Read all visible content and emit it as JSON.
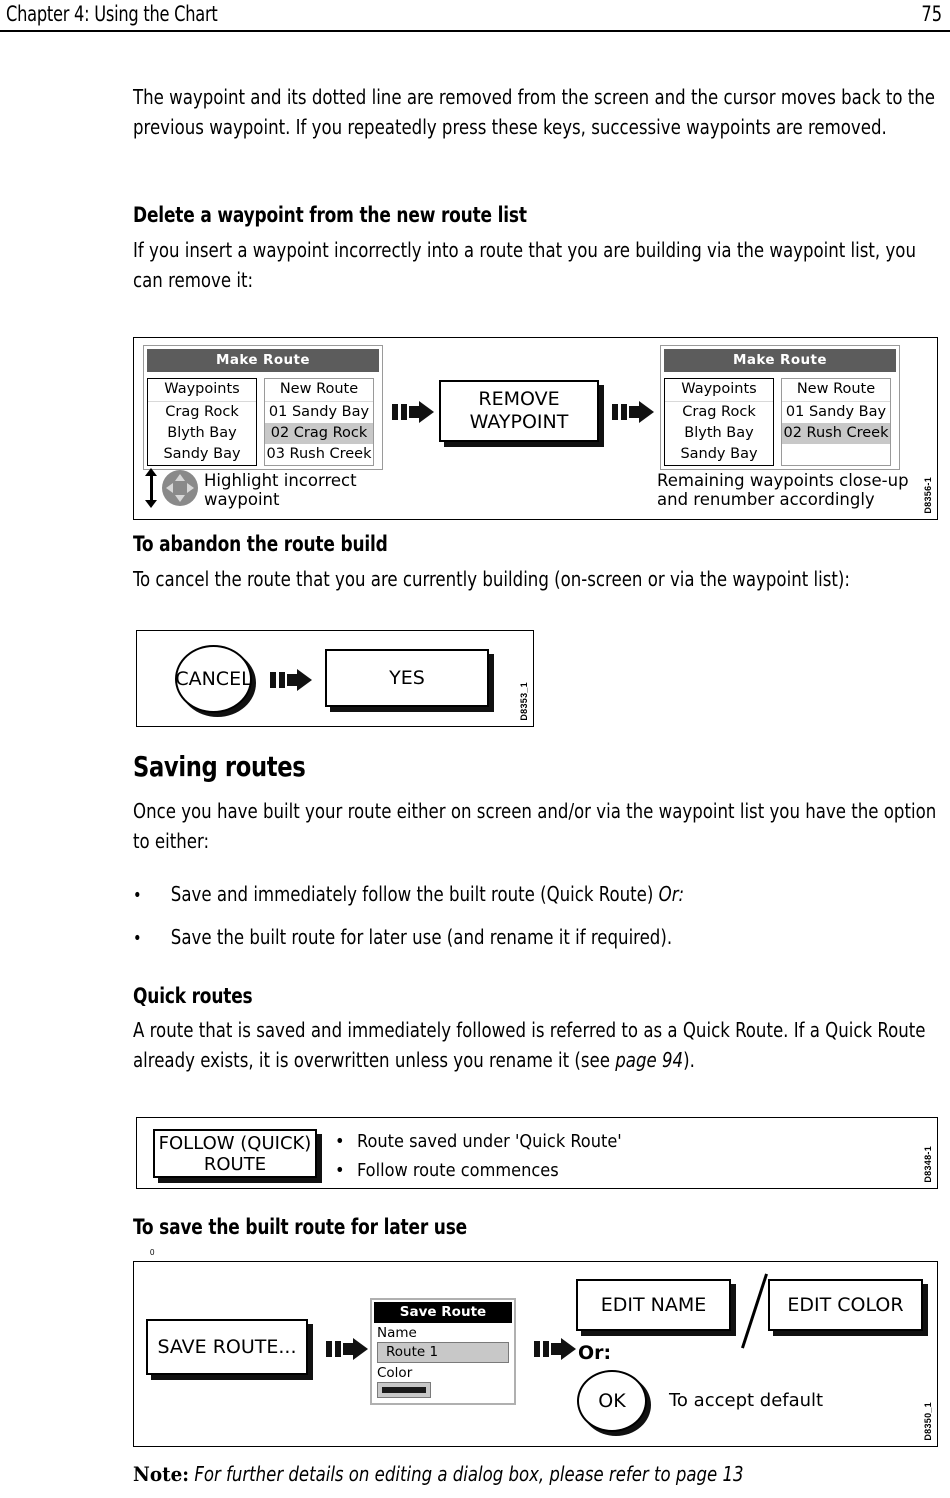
{
  "header": {
    "chapter": "Chapter 4: Using the Chart",
    "page_number": "75"
  },
  "body": {
    "intro_paragraph": "The waypoint and its dotted line are removed from the screen and the cursor moves back to the previous waypoint. If you repeatedly press these keys, successive waypoints are removed.",
    "heading_delete": "Delete a waypoint from the new route list",
    "para_delete": "If you insert a waypoint incorrectly into a route that you are building via the waypoint list, you can remove it:",
    "heading_abandon": "To abandon the route build",
    "para_abandon": "To cancel the route that you are currently building (on-screen or via the waypoint list):",
    "heading_saving": "Saving routes",
    "para_saving": "Once you have built your route either on screen and/or via the waypoint list you have the option to either:",
    "bullets": [
      {
        "text": "Save and immediately follow the built route (Quick Route) ",
        "italic": "Or:"
      },
      {
        "text": "Save the built route for later use (and rename it if required).",
        "italic": ""
      }
    ],
    "heading_quick": "Quick routes",
    "para_quick_a": "A route that is saved and immediately followed is referred to as a Quick Route. If a Quick Route already exists, it is overwritten unless you rename it (see ",
    "para_quick_ref": "page 94",
    "para_quick_b": ").",
    "heading_save_later": "To save the built route for later use",
    "tiny_mark": "0",
    "note_label": "Note:",
    "note_text": "For further details on editing a dialog box, please refer to page 13"
  },
  "figure_remove_waypoint": {
    "code": "D8356-1",
    "panel_before": {
      "title": "Make Route",
      "left_column": {
        "header": "Waypoints",
        "rows": [
          "Crag Rock",
          "Blyth Bay",
          "Sandy Bay"
        ]
      },
      "right_column": {
        "header": "New Route",
        "rows": [
          "01 Sandy Bay",
          "02 Crag Rock",
          "03 Rush Creek"
        ],
        "highlighted_index": 1
      }
    },
    "button": "REMOVE\nWAYPOINT",
    "panel_after": {
      "title": "Make Route",
      "left_column": {
        "header": "Waypoints",
        "rows": [
          "Crag Rock",
          "Blyth Bay",
          "Sandy Bay"
        ]
      },
      "right_column": {
        "header": "New Route",
        "rows": [
          "01 Sandy Bay",
          "02 Rush Creek"
        ],
        "highlighted_index": 1
      }
    },
    "caption_left": "Highlight incorrect\nwaypoint",
    "caption_right": "Remaining waypoints close-up\nand renumber accordingly"
  },
  "figure_cancel": {
    "code": "D8353_1",
    "cancel_label": "CANCEL",
    "yes_label": "YES"
  },
  "figure_quick_route": {
    "code": "D8348-1",
    "button": "FOLLOW (QUICK)\nROUTE",
    "bullets": [
      "Route saved under 'Quick Route'",
      "Follow route commences"
    ]
  },
  "figure_save_route": {
    "code": "D8350_1",
    "save_button": "SAVE ROUTE...",
    "dialog": {
      "title": "Save Route",
      "name_label": "Name",
      "name_value": "Route 1",
      "color_label": "Color",
      "color_swatch": "#1a1a1a"
    },
    "edit_name_button": "EDIT NAME",
    "edit_color_button": "EDIT COLOR",
    "or_label": "Or:",
    "ok_label": "OK",
    "ok_caption": "To accept default"
  },
  "colors": {
    "panel_title_bg": "#5c5c5c",
    "highlight_row": "#c8c8c8",
    "dialog_title_bg": "#000000",
    "dpad_body": "#8a8a8a"
  }
}
